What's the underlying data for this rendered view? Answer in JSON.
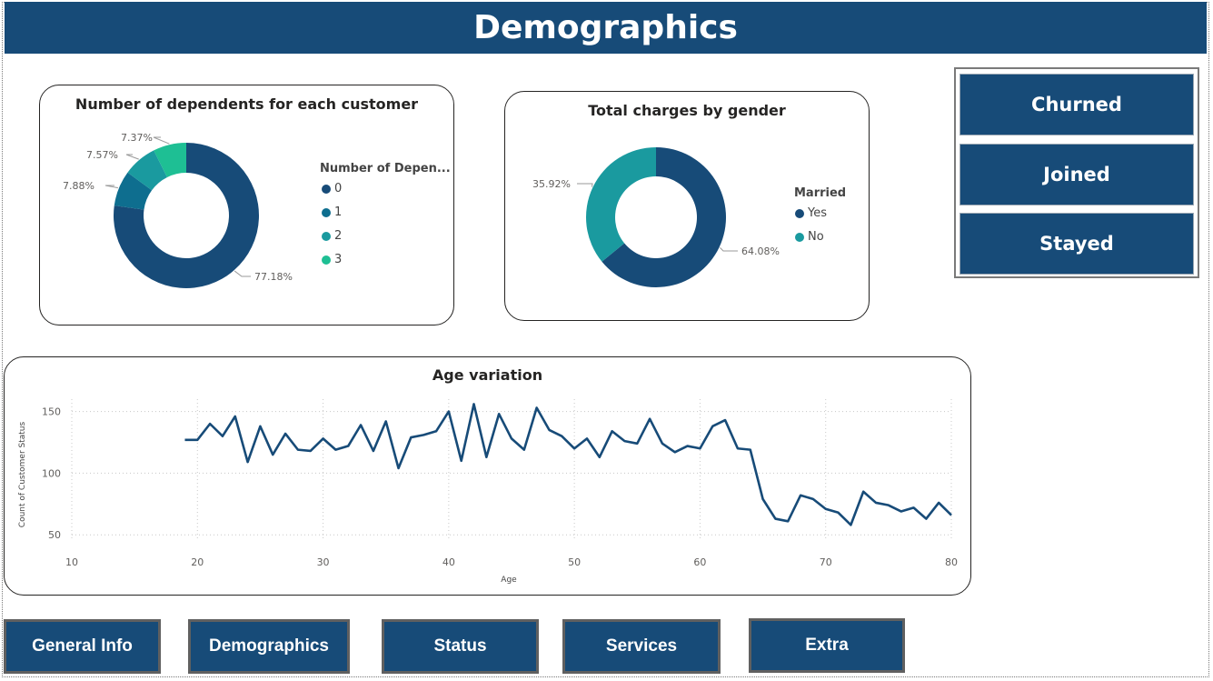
{
  "header": {
    "title": "Demographics"
  },
  "dependents_card": {
    "title": "Number of dependents for each customer",
    "legend_title": "Number of Depen...",
    "legend": [
      "0",
      "1",
      "2",
      "3"
    ]
  },
  "gender_card": {
    "title": "Total charges by gender",
    "legend_title": "Married",
    "legend": [
      "Yes",
      "No"
    ]
  },
  "slicer": {
    "buttons": [
      "Churned",
      "Joined",
      "Stayed"
    ]
  },
  "age_card": {
    "title": "Age variation"
  },
  "nav": {
    "buttons": [
      "General Info",
      "Demographics",
      "Status",
      "Services",
      "Extra"
    ]
  },
  "colors": {
    "brand": "#174b78",
    "teal_dark": "#0e6e8f",
    "teal": "#1a9a9f",
    "teal_light": "#1ebf94",
    "line": "#174b78"
  },
  "chart_data": [
    {
      "type": "pie",
      "title": "Number of dependents for each customer",
      "legend_title": "Number of Depen...",
      "categories": [
        "0",
        "1",
        "2",
        "3"
      ],
      "values": [
        77.18,
        7.88,
        7.57,
        7.37
      ],
      "labels": [
        "77.18%",
        "7.88%",
        "7.57%",
        "7.37%"
      ],
      "colors": [
        "#174b78",
        "#0e6e8f",
        "#1a9a9f",
        "#1ebf94"
      ],
      "legend_position": "right"
    },
    {
      "type": "pie",
      "title": "Total charges by gender",
      "legend_title": "Married",
      "categories": [
        "Yes",
        "No"
      ],
      "values": [
        64.08,
        35.92
      ],
      "labels": [
        "64.08%",
        "35.92%"
      ],
      "colors": [
        "#174b78",
        "#1a9a9f"
      ],
      "legend_position": "right"
    },
    {
      "type": "line",
      "title": "Age variation",
      "xlabel": "Age",
      "ylabel": "Count of Customer Status",
      "xlim": [
        10,
        80
      ],
      "ylim": [
        45,
        160
      ],
      "xticks": [
        10,
        20,
        30,
        40,
        50,
        60,
        70,
        80
      ],
      "yticks": [
        50,
        100,
        150
      ],
      "grid": true,
      "x": [
        19,
        20,
        21,
        22,
        23,
        24,
        25,
        26,
        27,
        28,
        29,
        30,
        31,
        32,
        33,
        34,
        35,
        36,
        37,
        38,
        39,
        40,
        41,
        42,
        43,
        44,
        45,
        46,
        47,
        48,
        49,
        50,
        51,
        52,
        53,
        54,
        55,
        56,
        57,
        58,
        59,
        60,
        61,
        62,
        63,
        64,
        65,
        66,
        67,
        68,
        69,
        70,
        71,
        72,
        73,
        74,
        75,
        76,
        77,
        78,
        79,
        80
      ],
      "y": [
        127,
        127,
        140,
        130,
        146,
        109,
        138,
        115,
        132,
        119,
        118,
        128,
        119,
        122,
        139,
        118,
        142,
        104,
        129,
        131,
        134,
        150,
        110,
        156,
        113,
        148,
        128,
        119,
        153,
        135,
        130,
        120,
        128,
        113,
        134,
        126,
        124,
        144,
        124,
        117,
        122,
        120,
        138,
        143,
        120,
        119,
        79,
        63,
        61,
        82,
        79,
        71,
        68,
        58,
        85,
        76,
        74,
        69,
        72,
        63,
        76,
        66
      ]
    }
  ]
}
